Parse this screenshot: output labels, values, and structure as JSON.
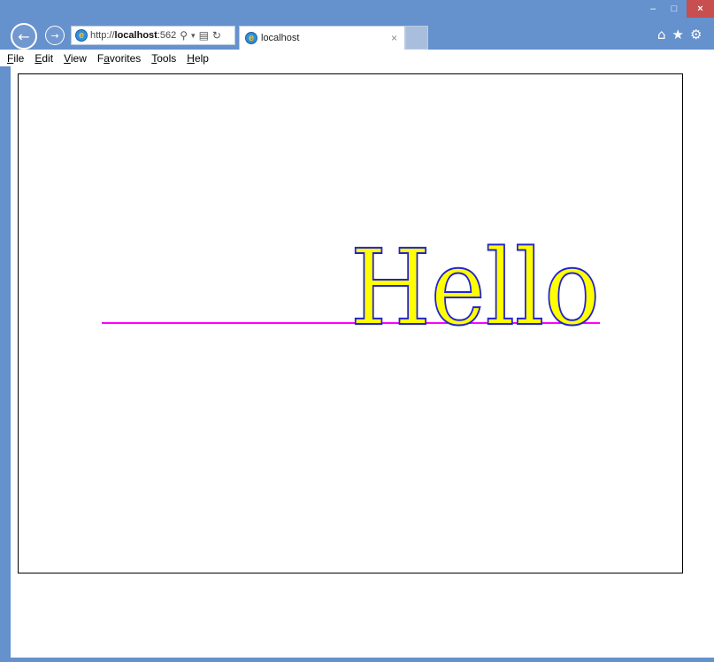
{
  "window": {
    "controls": {
      "minimize": "–",
      "maximize": "□",
      "close": "×"
    }
  },
  "nav": {
    "back_icon": "←",
    "forward_icon": "→",
    "address": {
      "scheme": "http://",
      "host": "localhost",
      "port": ":562",
      "search_icon": "⚲",
      "dropdown_icon": "▾",
      "compat_icon": "▤",
      "refresh_icon": "↻"
    },
    "tab": {
      "title": "localhost",
      "close_icon": "×"
    },
    "right_icons": {
      "home": "⌂",
      "favorites": "★",
      "settings": "⚙"
    }
  },
  "menu": {
    "items": [
      {
        "mnemonic": "F",
        "rest": "ile"
      },
      {
        "mnemonic": "E",
        "rest": "dit"
      },
      {
        "mnemonic": "V",
        "rest": "iew"
      },
      {
        "pre": "F",
        "mnemonic": "a",
        "rest": "vorites"
      },
      {
        "mnemonic": "T",
        "rest": "ools"
      },
      {
        "mnemonic": "H",
        "rest": "elp"
      }
    ]
  },
  "canvas": {
    "text": "Hello",
    "text_fill": "#ffff00",
    "text_stroke": "#2323d0",
    "baseline_color": "#ff00ff",
    "border_color": "#000000"
  },
  "colors": {
    "chrome": "#6591cd",
    "close_button": "#c74f4f"
  }
}
